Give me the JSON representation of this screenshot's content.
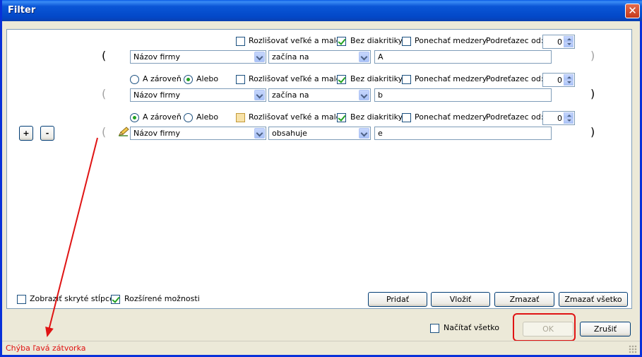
{
  "window": {
    "title": "Filter"
  },
  "icons": {
    "close": "close-icon",
    "edit_row": "pencil-icon"
  },
  "colors": {
    "status_error": "#e01010",
    "annotation": "#e01414",
    "title_bar": "#0a56d6"
  },
  "rows": [
    {
      "show_logic": false,
      "logic_and": "A zároveň",
      "logic_or": "Alebo",
      "logic_selected": "",
      "case_sensitive": "Rozlišovať veľké a malé",
      "no_diacritics": "Bez diakritiky",
      "keep_spaces": "Ponechať medzery",
      "substring_from": "Podreťazec od:",
      "substring_value": "0",
      "field": "Názov firmy",
      "operator": "začína na",
      "value": "A",
      "open_paren": "(",
      "close_paren": ")"
    },
    {
      "show_logic": true,
      "logic_and": "A zároveň",
      "logic_or": "Alebo",
      "logic_selected": "or",
      "case_sensitive": "Rozlišovať veľké a malé",
      "no_diacritics": "Bez diakritiky",
      "keep_spaces": "Ponechať medzery",
      "substring_from": "Podreťazec od:",
      "substring_value": "0",
      "field": "Názov firmy",
      "operator": "začína na",
      "value": "b",
      "open_paren": "(",
      "close_paren": ")"
    },
    {
      "show_logic": true,
      "logic_and": "A zároveň",
      "logic_or": "Alebo",
      "logic_selected": "and",
      "case_sensitive": "Rozlišovať veľké a malé",
      "no_diacritics": "Bez diakritiky",
      "keep_spaces": "Ponechať medzery",
      "substring_from": "Podreťazec od:",
      "substring_value": "0",
      "field": "Názov firmy",
      "operator": "obsahuje",
      "value": "e",
      "open_paren": "(",
      "close_paren": ")"
    }
  ],
  "paren_buttons": {
    "plus": "+",
    "minus": "-"
  },
  "bottom": {
    "show_hidden_columns": "Zobraziť skryté stĺpce",
    "extended_options": "Rozšírené možnosti",
    "add": "Pridať",
    "insert": "Vložiť",
    "delete": "Zmazať",
    "delete_all": "Zmazať všetko",
    "load_all": "Načítať všetko",
    "ok": "OK",
    "cancel": "Zrušiť"
  },
  "status": {
    "message": "Chýba ľavá zátvorka"
  }
}
